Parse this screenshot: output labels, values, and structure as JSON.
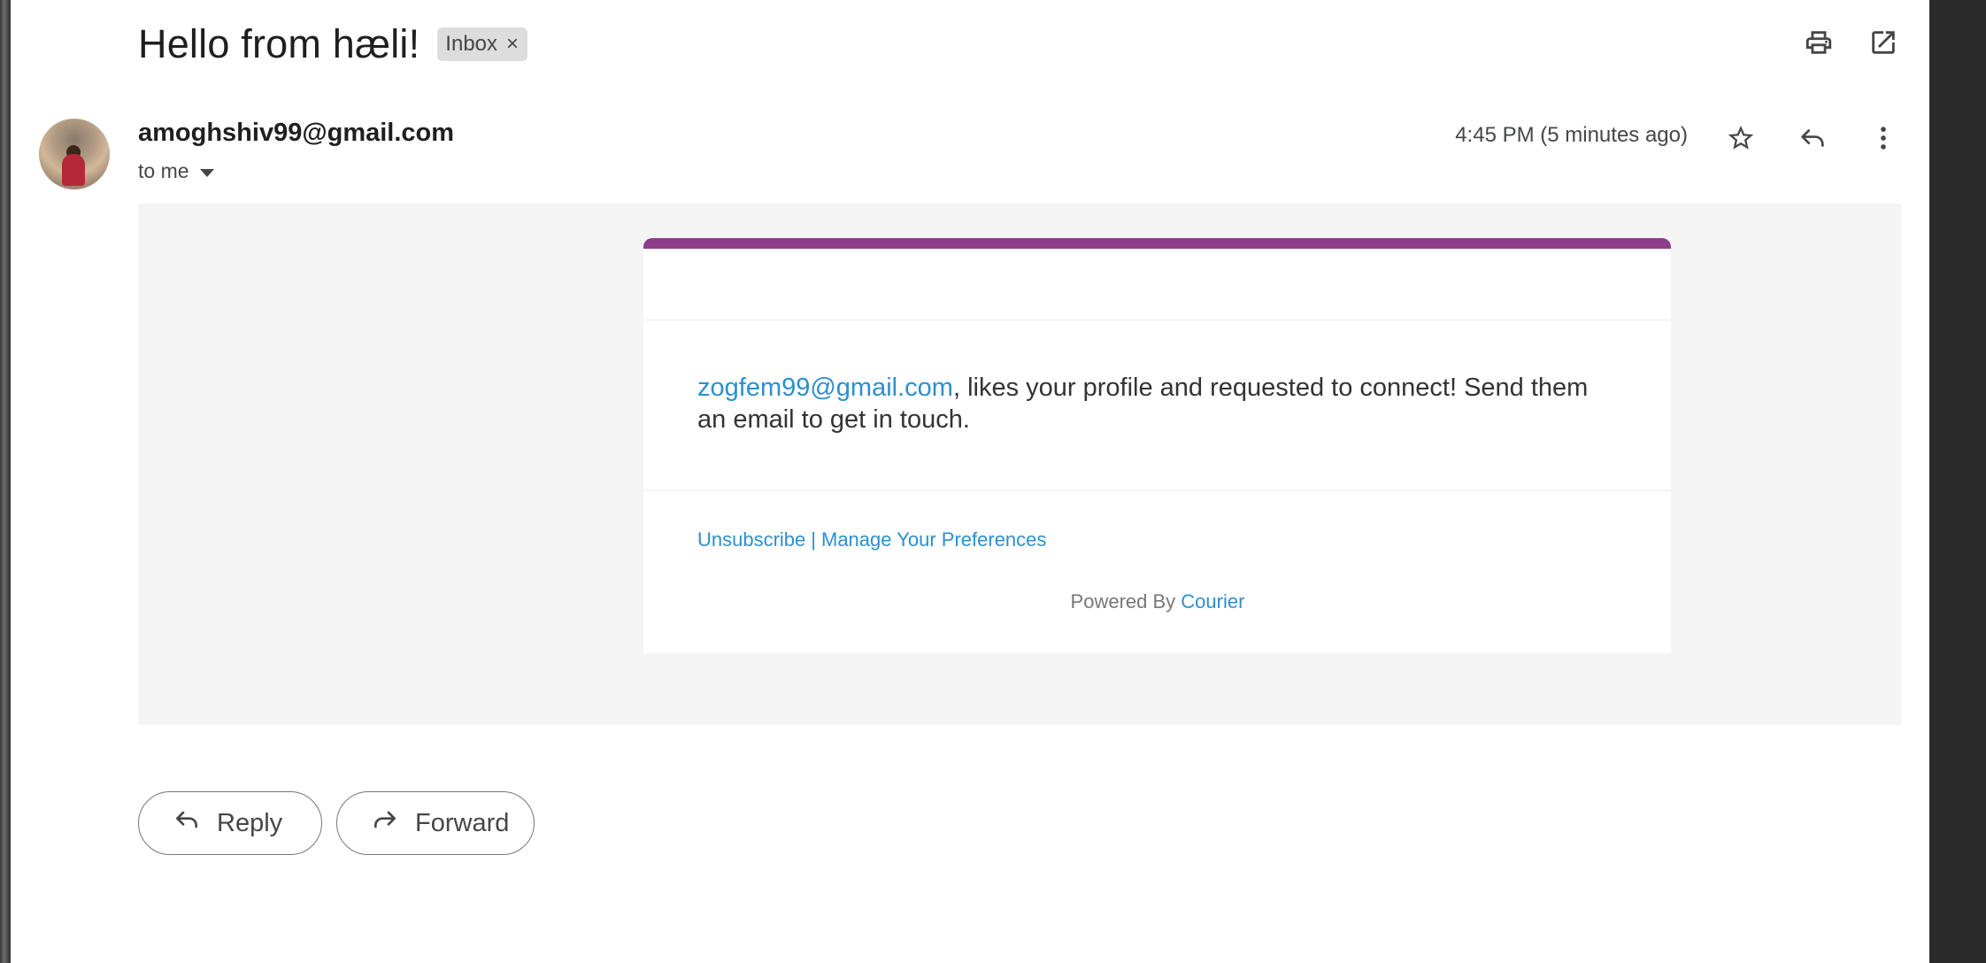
{
  "email": {
    "subject": "Hello from hæli!",
    "label": "Inbox",
    "label_remove": "×",
    "sender": "amoghshiv99@gmail.com",
    "recipient": "to me",
    "timestamp": "4:45 PM (5 minutes ago)"
  },
  "icons": {
    "print": "print-icon",
    "open_new_window": "open-in-new-window-icon",
    "star": "star-icon",
    "reply": "reply-icon",
    "more": "more-vert-icon",
    "dropdown": "arrow-drop-down-icon",
    "forward": "forward-icon"
  },
  "body": {
    "sender_link": "zogfem99@gmail.com",
    "message": ", likes your profile and requested to connect! Send them an email to get in touch.",
    "unsubscribe": "Unsubscribe",
    "separator": "|",
    "manage_preferences": "Manage Your Preferences",
    "powered_by": "Powered By",
    "provider": "Courier"
  },
  "actions": {
    "reply": "Reply",
    "forward": "Forward"
  },
  "colors": {
    "accent_bar": "#8c3d89",
    "link": "#2c8fd0",
    "body_background": "#f4f4f4"
  }
}
